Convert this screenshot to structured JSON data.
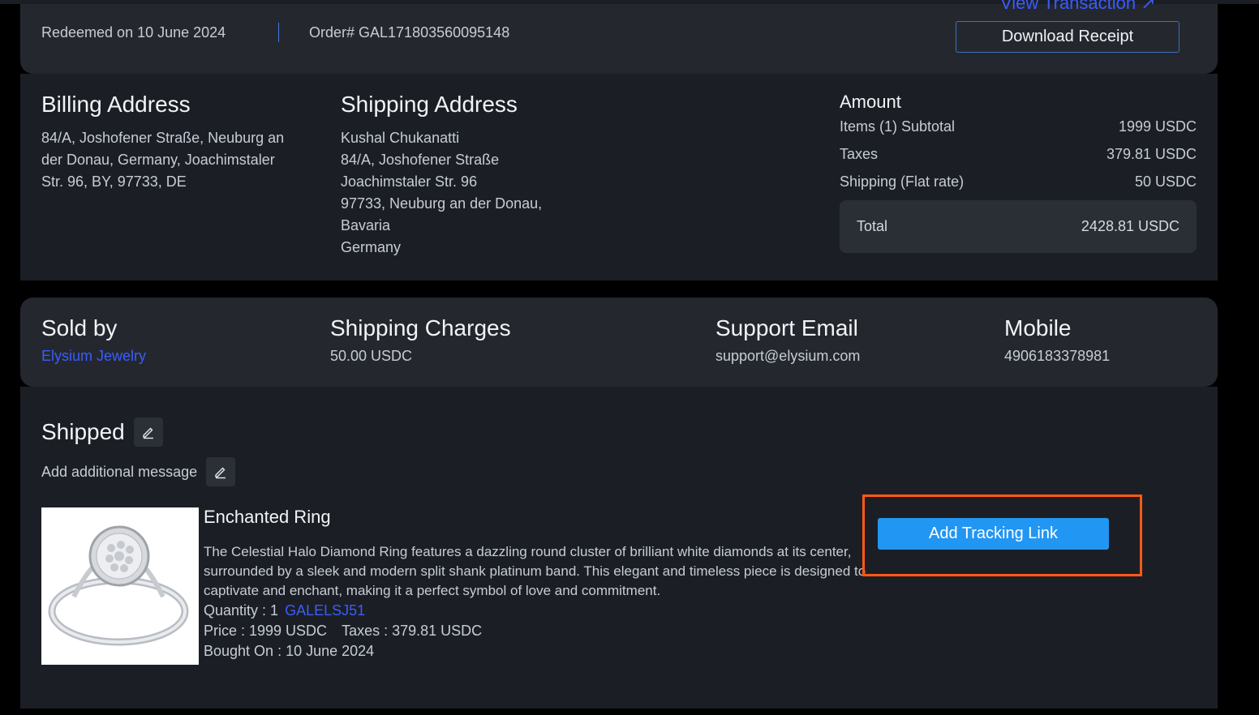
{
  "header": {
    "view_transaction": "View Transaction ↗",
    "redeemed": "Redeemed on 10 June 2024",
    "order_number": "Order# GAL171803560095148",
    "download_receipt": "Download Receipt"
  },
  "billing": {
    "title": "Billing Address",
    "lines": [
      "84/A, Joshofener Straße, Neuburg an",
      "der Donau, Germany, Joachimstaler",
      "Str. 96, BY, 97733, DE"
    ]
  },
  "shipping": {
    "title": "Shipping Address",
    "lines": [
      "Kushal Chukanatti",
      "84/A, Joshofener Straße",
      "Joachimstaler Str. 96",
      "97733, Neuburg an der Donau,",
      "Bavaria",
      "Germany"
    ]
  },
  "amount": {
    "title": "Amount",
    "rows": [
      {
        "label": "Items (1) Subtotal",
        "value": "1999 USDC"
      },
      {
        "label": "Taxes",
        "value": "379.81 USDC"
      },
      {
        "label": "Shipping (Flat rate)",
        "value": "50 USDC"
      }
    ],
    "total_label": "Total",
    "total_value": "2428.81 USDC"
  },
  "seller": {
    "sold_by_title": "Sold by",
    "sold_by_value": "Elysium Jewelry",
    "shipping_charges_title": "Shipping Charges",
    "shipping_charges_value": "50.00 USDC",
    "support_email_title": "Support Email",
    "support_email_value": "support@elysium.com",
    "mobile_title": "Mobile",
    "mobile_value": "4906183378981"
  },
  "order": {
    "status": "Shipped",
    "add_message": "Add additional message",
    "add_tracking": "Add Tracking Link",
    "icons": {
      "edit": "pencil-edit-icon"
    },
    "product": {
      "title": "Enchanted Ring",
      "description": "The Celestial Halo Diamond Ring features a dazzling round cluster of brilliant white diamonds at its center, surrounded by a sleek and modern split shank platinum band. This elegant and timeless piece is designed to captivate and enchant, making it a perfect symbol of love and commitment.",
      "quantity": "Quantity : 1",
      "sku": "GALELSJ51",
      "price": "Price : 1999 USDC",
      "taxes": "Taxes : 379.81 USDC",
      "bought_on": "Bought On : 10 June 2024"
    }
  },
  "colors": {
    "accent_link": "#3a5cff",
    "button_primary": "#2196f3",
    "highlight": "#ff5a14"
  }
}
